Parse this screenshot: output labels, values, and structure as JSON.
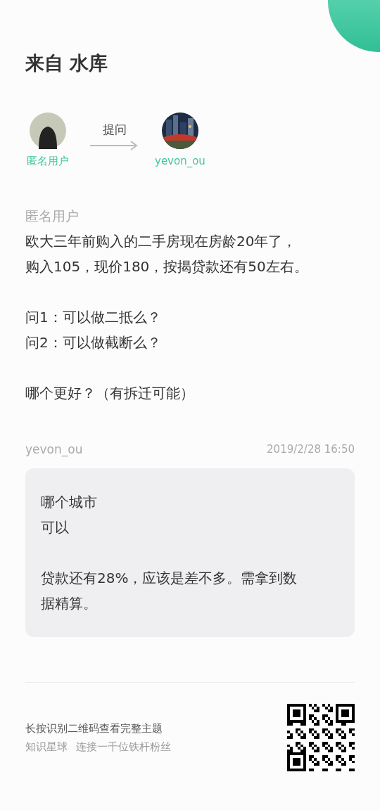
{
  "title": "来自 水库",
  "asker": {
    "name": "匿名用户"
  },
  "action": "提问",
  "answerer": {
    "name": "yevon_ou"
  },
  "question": {
    "author": "匿名用户",
    "paragraphs": [
      [
        "欧大三年前购入的二手房现在房龄20年了，",
        "购入105，现价180，按揭贷款还有50左右。"
      ],
      [
        "问1：可以做二抵么？",
        "问2：可以做截断么？"
      ],
      [
        "哪个更好？（有拆迁可能）"
      ]
    ]
  },
  "answer": {
    "author": "yevon_ou",
    "time": "2019/2/28 16:50",
    "paragraphs": [
      [
        "哪个城市",
        "可以"
      ],
      [
        "贷款还有28%，应该是差不多。需拿到数",
        "据精算。"
      ]
    ]
  },
  "footer": {
    "hint": "长按识别二维码查看完整主题",
    "source": "知识星球",
    "tagline": "连接一千位铁杆粉丝"
  }
}
